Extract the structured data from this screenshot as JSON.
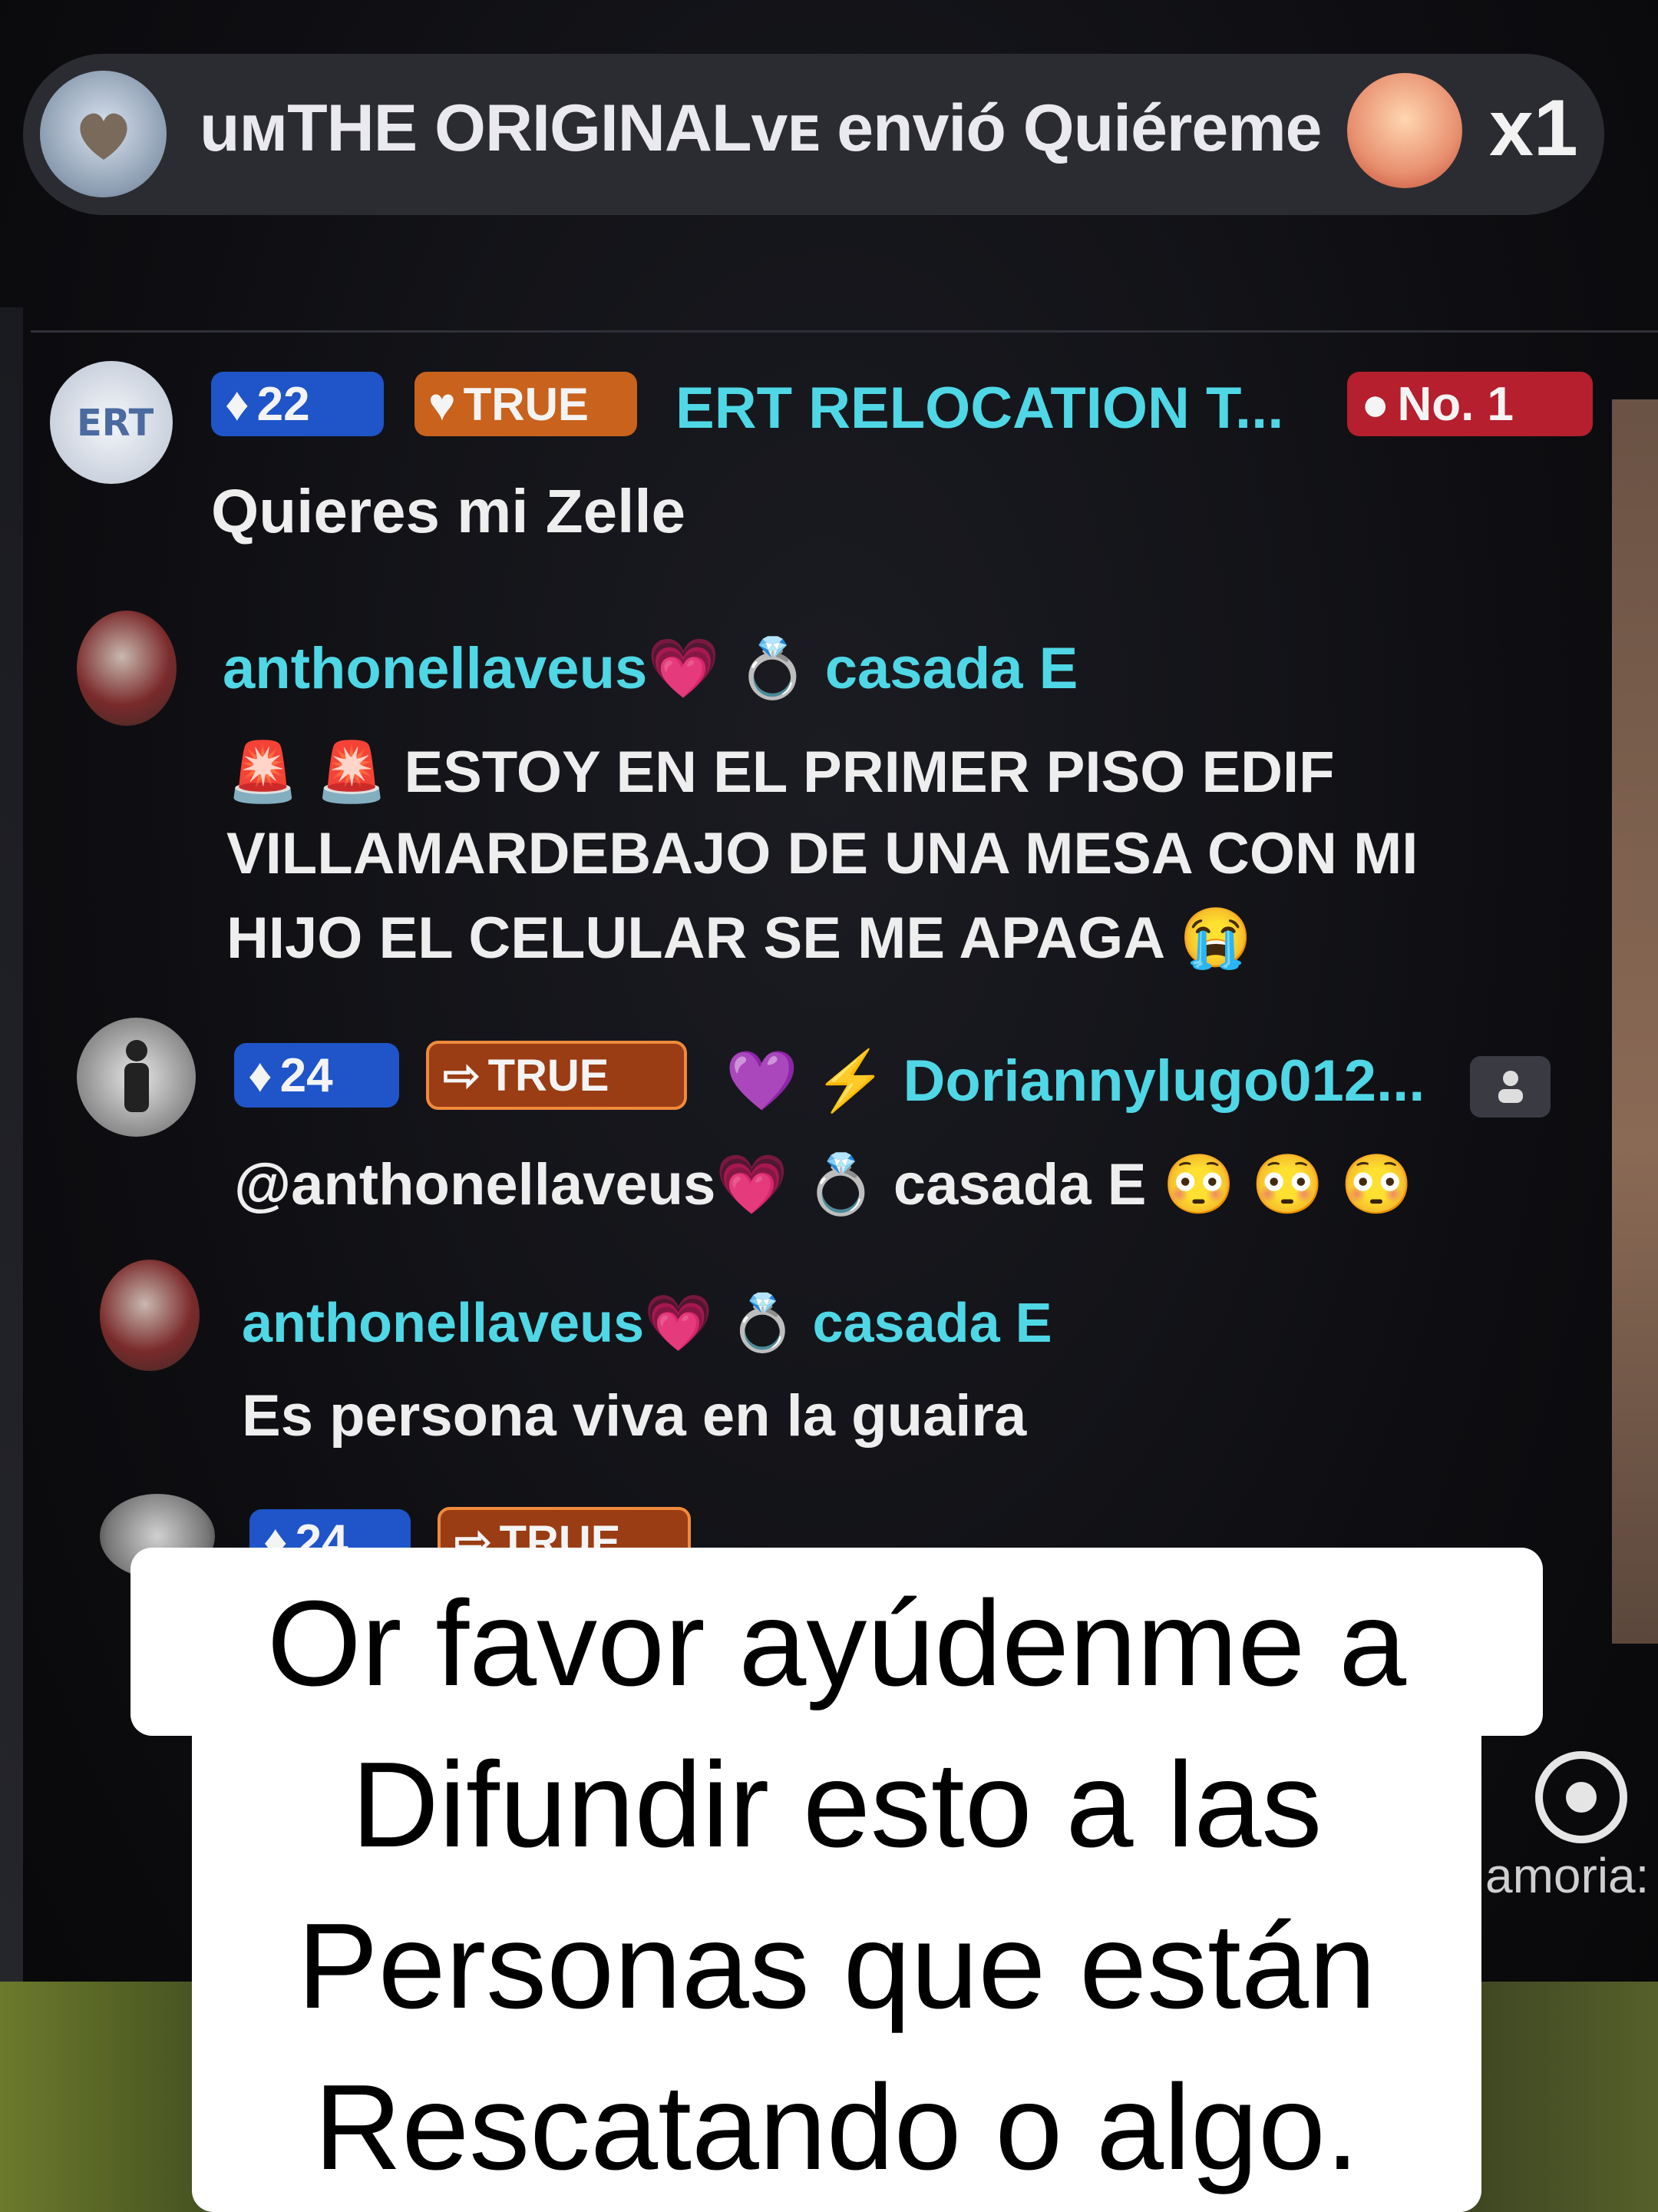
{
  "gift_banner": {
    "text": "uмTHE ORIGINALvᴇ envió Quiéreme",
    "count": "x1",
    "gift_icon": "quiereme-gift-icon"
  },
  "comments": [
    {
      "level": "22",
      "tag": "TRUE",
      "username": "ERT RELOCATION T...",
      "rank_badge": "No. 1",
      "message": "Quieres mi Zelle"
    },
    {
      "username": "anthonellaveus💗 💍 casada E",
      "message_lines": [
        "🚨 🚨 ESTOY EN EL PRIMER PISO EDIF",
        "VILLAMARDEBAJO DE UNA MESA CON MI",
        "HIJO EL CELULAR SE ME APAGA 😭"
      ]
    },
    {
      "level": "24",
      "tag": "TRUE",
      "username": "💜 ⚡ Doriannylugo012...",
      "message": "@anthonellaveus💗 💍 casada E 😳 😳 😳"
    },
    {
      "username": "anthonellaveus💗 💍 casada E",
      "message": "Es persona viva en la guaira"
    },
    {
      "level": "24",
      "tag": "TRUE"
    }
  ],
  "caption_lines": [
    "Or favor ayúdenme a",
    "Difundir esto a las",
    "Personas que están",
    "Rescatando o algo."
  ],
  "side_label": "amoria:"
}
